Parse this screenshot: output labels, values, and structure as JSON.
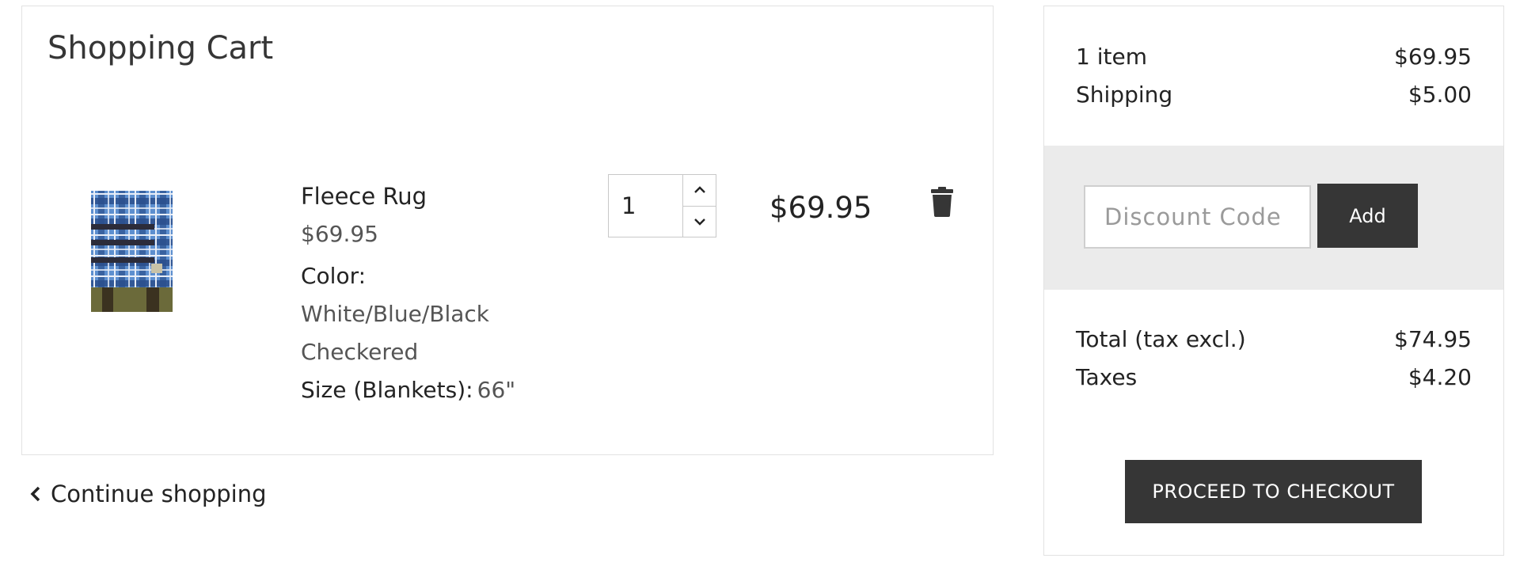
{
  "cart": {
    "title": "Shopping Cart",
    "item": {
      "name": "Fleece Rug",
      "unit_price": "$69.95",
      "color_label": "Color:",
      "color_value_line1": "White/Blue/Black",
      "color_value_line2": "Checkered",
      "size_label": "Size (Blankets):",
      "size_value": "66\"",
      "quantity": "1",
      "line_total": "$69.95",
      "image_icon": "plaid-blanket-product-image"
    },
    "continue_label": "Continue shopping"
  },
  "summary": {
    "items_label": "1 item",
    "items_value": "$69.95",
    "shipping_label": "Shipping",
    "shipping_value": "$5.00",
    "discount_placeholder": "Discount Code",
    "discount_button": "Add",
    "total_label": "Total (tax excl.)",
    "total_value": "$74.95",
    "taxes_label": "Taxes",
    "taxes_value": "$4.20",
    "checkout_button": "PROCEED TO CHECKOUT"
  },
  "colors": {
    "dark_button": "#363636",
    "band": "#ebebeb",
    "border": "#e2e2e2"
  }
}
